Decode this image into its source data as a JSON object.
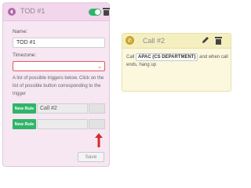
{
  "tod": {
    "title": "TOD #1",
    "name_label": "Name:",
    "name_value": "TOD #1",
    "timezone_label": "Timezone:",
    "timezone_value": "",
    "help_text": "A list of possible triggers below. Click on the list of possible button corresponding to the trigger",
    "rules": [
      {
        "button": "New Rule",
        "value": "Call #2"
      },
      {
        "button": "New Rule",
        "value": ""
      }
    ],
    "save_label": "Save",
    "enabled": true
  },
  "call": {
    "title": "Call #2",
    "text_prefix": "Call",
    "department": "APAC (CS DEPARTMENT)",
    "text_suffix": "and when call ends, hang up"
  },
  "colors": {
    "tod_background": "#f6e7f3",
    "call_background": "#fbf8de",
    "rule_button": "#2fb56a",
    "toggle_on": "#2fb56a",
    "error_border": "#e35b5b",
    "arrow": "#d62a2a"
  }
}
